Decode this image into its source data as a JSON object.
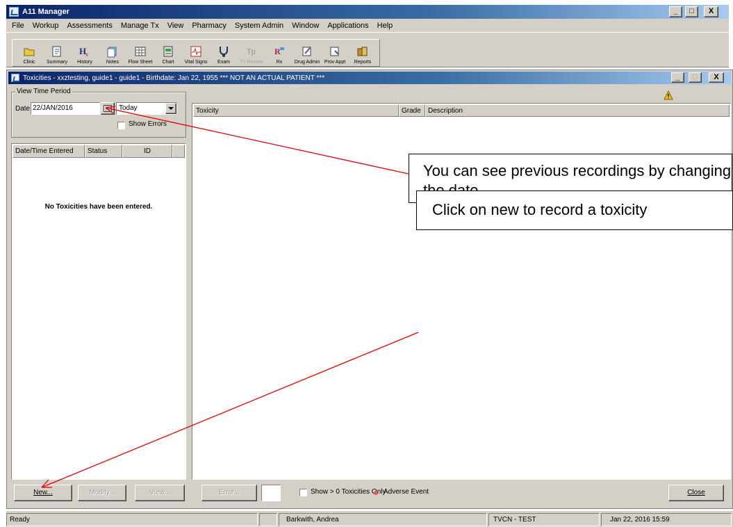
{
  "app": {
    "title": "A11 Manager",
    "window_buttons": [
      "_",
      "□",
      "X"
    ]
  },
  "menu": [
    "File",
    "Workup",
    "Assessments",
    "Manage Tx",
    "View",
    "Pharmacy",
    "System Admin",
    "Window",
    "Applications",
    "Help"
  ],
  "toolbar": [
    {
      "label": "Clinic",
      "icon": "folder-icon",
      "enabled": true
    },
    {
      "label": "Summary",
      "icon": "summary-icon",
      "enabled": true
    },
    {
      "label": "History",
      "icon": "history-icon",
      "enabled": true
    },
    {
      "label": "Notes",
      "icon": "notes-icon",
      "enabled": true
    },
    {
      "label": "Flow Sheet",
      "icon": "flowsheet-icon",
      "enabled": true
    },
    {
      "label": "Chart",
      "icon": "chart-icon",
      "enabled": true
    },
    {
      "label": "Vital Signs",
      "icon": "vital-signs-icon",
      "enabled": true
    },
    {
      "label": "Exam",
      "icon": "exam-icon",
      "enabled": true
    },
    {
      "label": "Tx Review",
      "icon": "tx-review-icon",
      "enabled": false
    },
    {
      "label": "Rx",
      "icon": "rx-icon",
      "enabled": true
    },
    {
      "label": "Drug Admin",
      "icon": "drug-admin-icon",
      "enabled": true
    },
    {
      "label": "Prov Appt",
      "icon": "prov-appt-icon",
      "enabled": true
    },
    {
      "label": "Reports",
      "icon": "reports-icon",
      "enabled": true
    }
  ],
  "child_window": {
    "title": "Toxicities - xxztesting, guide1 - guide1 - Birthdate: Jan 22, 1955 *** NOT AN ACTUAL PATIENT ***",
    "buttons": [
      "_",
      "□",
      "X"
    ]
  },
  "time_period": {
    "group_label": "View Time Period",
    "date_label": "Date",
    "date_value": "22/JAN/2016",
    "range_value": "Today",
    "show_errors_label": "Show Errors",
    "show_errors_checked": false
  },
  "left_list": {
    "columns": [
      "Date/Time Entered",
      "Status",
      "ID"
    ],
    "empty_message": "No Toxicities have been entered."
  },
  "right_table": {
    "columns": [
      "Toxicity",
      "Grade",
      "Description"
    ]
  },
  "bottom_bar": {
    "new_label": "New...",
    "modify_label": "Modify...",
    "view_label": "View...",
    "error_label": "Error...",
    "show_only_label": "Show > 0 Toxicities Only",
    "adverse_label": "Adverse Event",
    "adverse_color": "#d06060",
    "close_label": "Close"
  },
  "status_bar": {
    "ready": "Ready",
    "user": "Barkwith, Andrea",
    "env": "TVCN - TEST",
    "datetime": "Jan 22, 2016 15:59"
  },
  "callouts": {
    "date_note": "You can see previous recordings by changing the date",
    "new_note": "Click on new to record a toxicity"
  },
  "annotation_color": "#e00000"
}
